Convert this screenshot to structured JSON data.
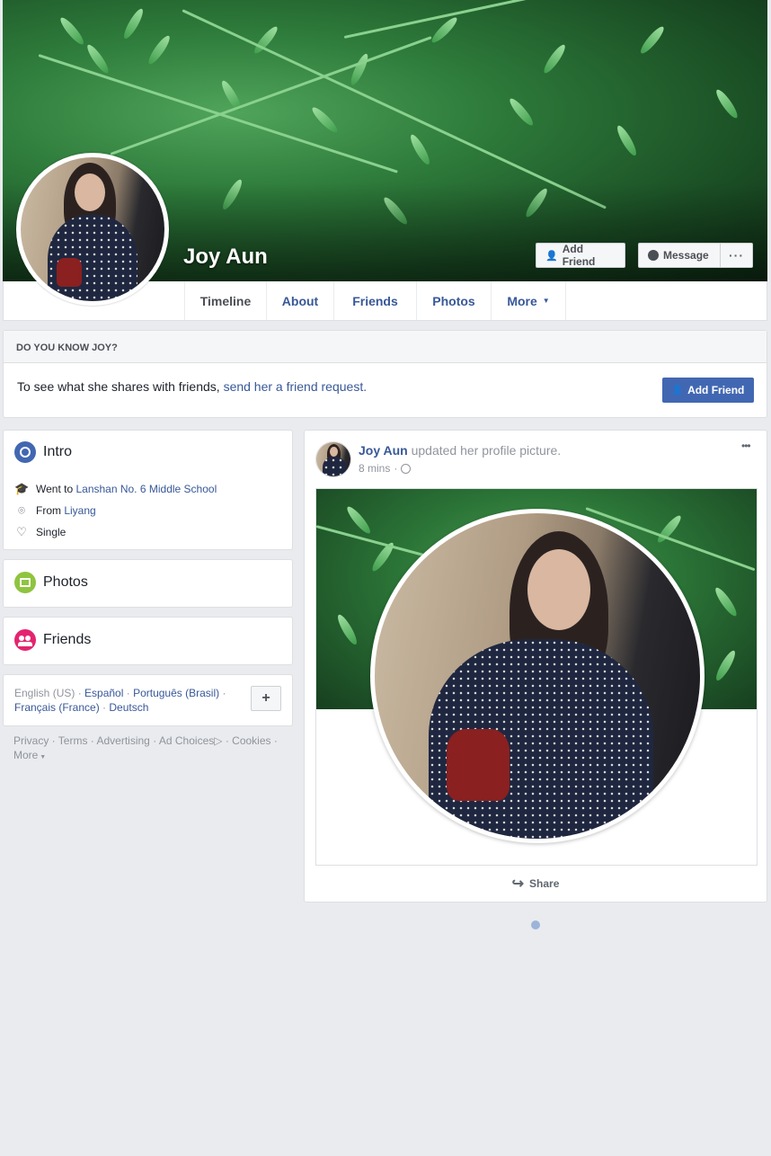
{
  "profile": {
    "name": "Joy Aun"
  },
  "cover_buttons": {
    "add_friend": "Add Friend",
    "message": "Message",
    "more": "···"
  },
  "nav": {
    "tabs": [
      "Timeline",
      "About",
      "Friends",
      "Photos",
      "More"
    ]
  },
  "know_card": {
    "heading": "DO YOU KNOW JOY?",
    "text": "To see what she shares with friends, ",
    "link": "send her a friend request.",
    "button": "Add Friend"
  },
  "intro": {
    "title": "Intro",
    "went_prefix": "Went to ",
    "school": "Lanshan No. 6 Middle School",
    "from_prefix": "From ",
    "hometown": "Liyang",
    "relationship": "Single"
  },
  "photos_title": "Photos",
  "friends_title": "Friends",
  "languages": {
    "current": "English (US)",
    "others": [
      "Español",
      "Português (Brasil)",
      "Français (France)",
      "Deutsch"
    ],
    "add": "+"
  },
  "footer": {
    "links": [
      "Privacy",
      "Terms",
      "Advertising",
      "Ad Choices",
      "Cookies",
      "More"
    ]
  },
  "post": {
    "author": "Joy Aun",
    "action": " updated her profile picture.",
    "time": "8 mins",
    "share": "Share",
    "menu": "•••"
  },
  "colors": {
    "link": "#385898",
    "primary_button": "#4267b2",
    "background": "#e9ebee",
    "intro_icon": "#4267b2",
    "photos_icon": "#8fc43f",
    "friends_icon": "#e4246e"
  }
}
